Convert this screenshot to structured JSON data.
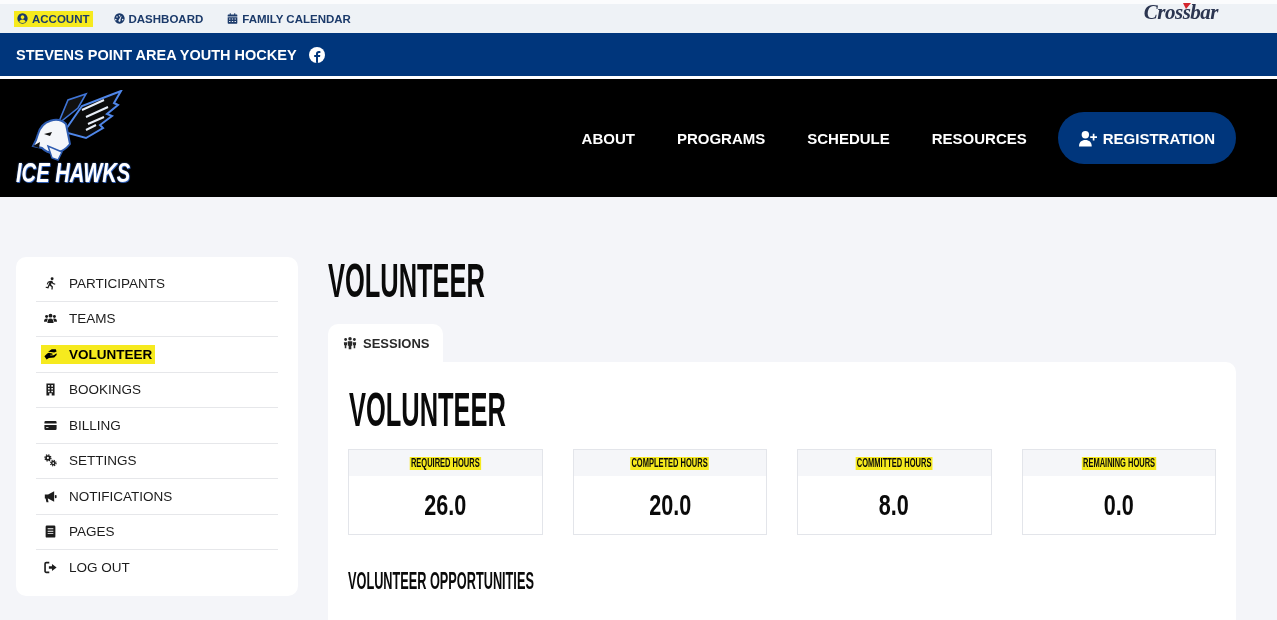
{
  "top_bar": {
    "links": [
      {
        "label": "ACCOUNT",
        "highlighted": true
      },
      {
        "label": "DASHBOARD",
        "highlighted": false
      },
      {
        "label": "FAMILY CALENDAR",
        "highlighted": false
      }
    ],
    "brand_logo": "Crossbar"
  },
  "org_bar": {
    "title": "STEVENS POINT AREA YOUTH HOCKEY"
  },
  "header": {
    "logo_text": "ICE HAWKS",
    "nav": [
      "ABOUT",
      "PROGRAMS",
      "SCHEDULE",
      "RESOURCES"
    ],
    "cta": "REGISTRATION"
  },
  "sidebar": {
    "items": [
      {
        "label": "PARTICIPANTS",
        "selected": false,
        "highlighted": false
      },
      {
        "label": "TEAMS",
        "selected": false,
        "highlighted": false
      },
      {
        "label": "VOLUNTEER",
        "selected": true,
        "highlighted": true
      },
      {
        "label": "BOOKINGS",
        "selected": false,
        "highlighted": false
      },
      {
        "label": "BILLING",
        "selected": false,
        "highlighted": false
      },
      {
        "label": "SETTINGS",
        "selected": false,
        "highlighted": false
      },
      {
        "label": "NOTIFICATIONS",
        "selected": false,
        "highlighted": false
      },
      {
        "label": "PAGES",
        "selected": false,
        "highlighted": false
      },
      {
        "label": "LOG OUT",
        "selected": false,
        "highlighted": false
      }
    ]
  },
  "main": {
    "title": "VOLUNTEER",
    "tabs": [
      {
        "label": "SESSIONS",
        "selected": true
      }
    ],
    "panel": {
      "title": "VOLUNTEER",
      "stats": [
        {
          "label": "REQUIRED HOURS",
          "value": "26.0",
          "highlighted": true
        },
        {
          "label": "COMPLETED HOURS",
          "value": "20.0",
          "highlighted": true
        },
        {
          "label": "COMMITTED HOURS",
          "value": "8.0",
          "highlighted": true
        },
        {
          "label": "REMAINING HOURS",
          "value": "0.0",
          "highlighted": true
        }
      ],
      "section_title": "VOLUNTEER OPPORTUNITIES"
    }
  }
}
